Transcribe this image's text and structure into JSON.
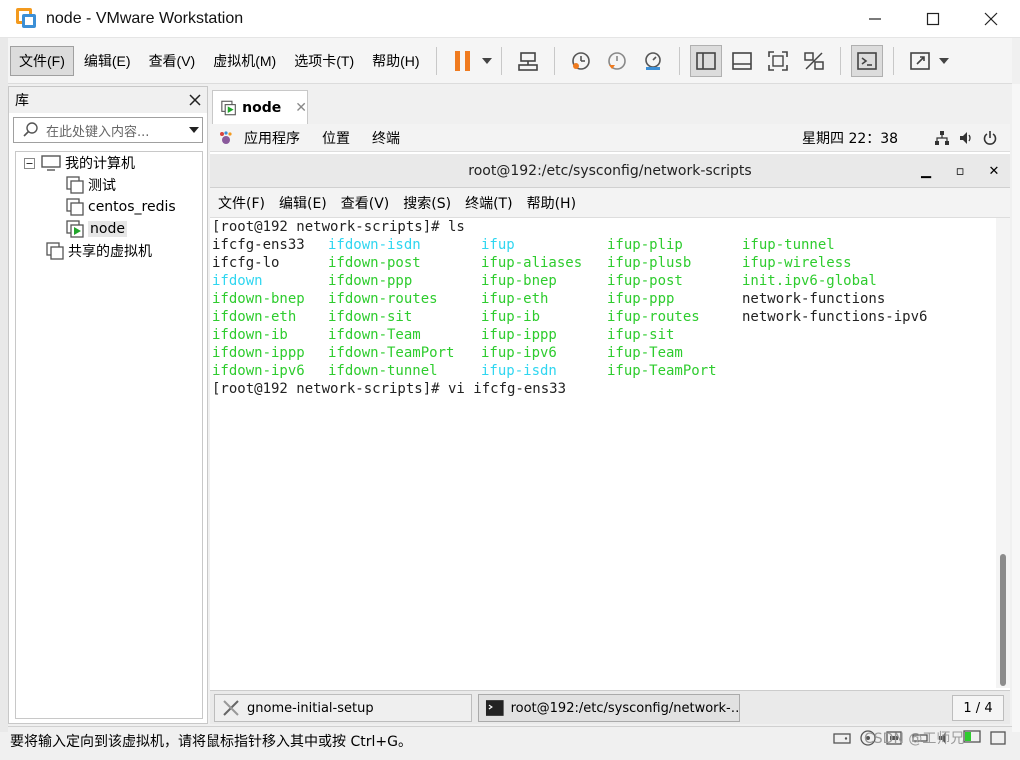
{
  "window": {
    "title": "node - VMware Workstation"
  },
  "menu": [
    "文件(F)",
    "编辑(E)",
    "查看(V)",
    "虚拟机(M)",
    "选项卡(T)",
    "帮助(H)"
  ],
  "library": {
    "title": "库",
    "search_placeholder": "在此处键入内容...",
    "tree": {
      "root": "我的计算机",
      "vms": [
        "测试",
        "centos_redis",
        "node"
      ],
      "shared": "共享的虚拟机"
    }
  },
  "tab": {
    "label": "node"
  },
  "gnome": {
    "apps": "应用程序",
    "places": "位置",
    "terminal": "终端",
    "clock": "星期四 22：38"
  },
  "terminal": {
    "title": "root@192:/etc/sysconfig/network-scripts",
    "menu": [
      "文件(F)",
      "编辑(E)",
      "查看(V)",
      "搜索(S)",
      "终端(T)",
      "帮助(H)"
    ],
    "prompt1": "[root@192 network-scripts]# ls",
    "prompt2": "[root@192 network-scripts]# vi ifcfg-ens33",
    "files": [
      [
        "ifcfg-ens33",
        "ifdown-isdn",
        "ifup",
        "ifup-plip",
        "ifup-tunnel"
      ],
      [
        "ifcfg-lo",
        "ifdown-post",
        "ifup-aliases",
        "ifup-plusb",
        "ifup-wireless"
      ],
      [
        "ifdown",
        "ifdown-ppp",
        "ifup-bnep",
        "ifup-post",
        "init.ipv6-global"
      ],
      [
        "ifdown-bnep",
        "ifdown-routes",
        "ifup-eth",
        "ifup-ppp",
        "network-functions"
      ],
      [
        "ifdown-eth",
        "ifdown-sit",
        "ifup-ib",
        "ifup-routes",
        "network-functions-ipv6"
      ],
      [
        "ifdown-ib",
        "ifdown-Team",
        "ifup-ippp",
        "ifup-sit",
        ""
      ],
      [
        "ifdown-ippp",
        "ifdown-TeamPort",
        "ifup-ipv6",
        "ifup-Team",
        ""
      ],
      [
        "ifdown-ipv6",
        "ifdown-tunnel",
        "ifup-isdn",
        "ifup-TeamPort",
        ""
      ]
    ],
    "colors": [
      [
        "white",
        "cyan",
        "cyan",
        "green",
        "green"
      ],
      [
        "white",
        "green",
        "green",
        "green",
        "green"
      ],
      [
        "cyan",
        "green",
        "green",
        "green",
        "green"
      ],
      [
        "green",
        "green",
        "green",
        "green",
        "white"
      ],
      [
        "green",
        "green",
        "green",
        "green",
        "white"
      ],
      [
        "green",
        "green",
        "green",
        "green",
        ""
      ],
      [
        "green",
        "green",
        "green",
        "green",
        ""
      ],
      [
        "green",
        "green",
        "cyan",
        "green",
        ""
      ]
    ]
  },
  "taskbar": {
    "task1": "gnome-initial-setup",
    "task2": "root@192:/etc/sysconfig/network-…",
    "pager": "1 / 4"
  },
  "status": {
    "text": "要将输入定向到该虚拟机，请将鼠标指针移入其中或按 Ctrl+G。"
  },
  "watermark": "CSDN @工师兄",
  "colors": {
    "green": "#2ecc2e",
    "cyan": "#2fd6f0",
    "pause": "#f07b1f"
  }
}
